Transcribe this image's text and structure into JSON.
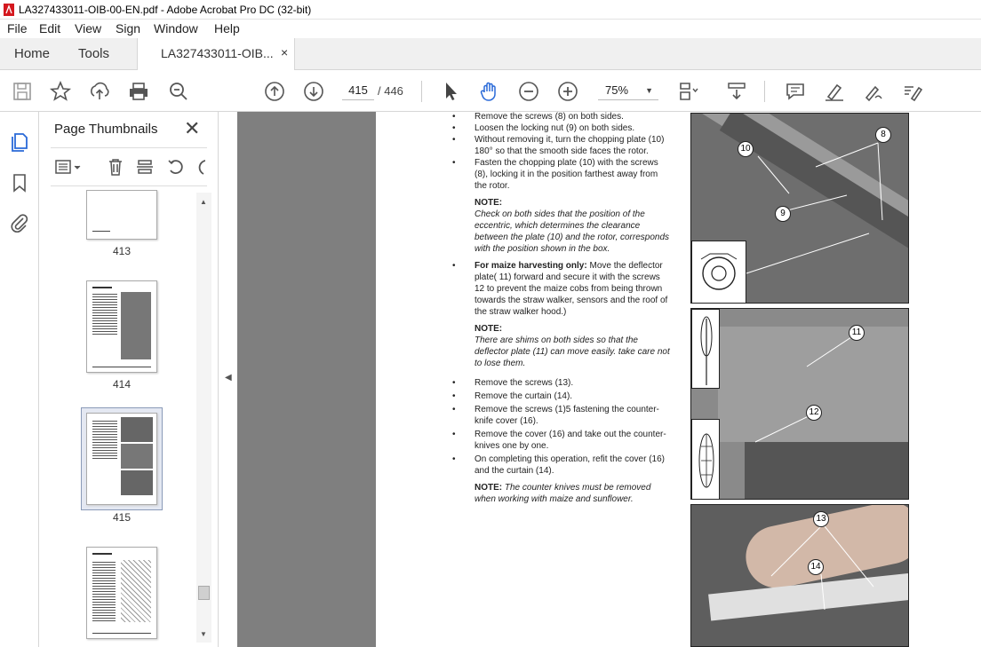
{
  "window": {
    "title": "LA327433011-OIB-00-EN.pdf - Adobe Acrobat Pro DC (32-bit)"
  },
  "menu": [
    "File",
    "Edit",
    "View",
    "Sign",
    "Window",
    "Help"
  ],
  "tabs": {
    "home": "Home",
    "tools": "Tools",
    "document": "LA327433011-OIB...",
    "close": "×"
  },
  "toolbar": {
    "current_page": "415",
    "page_total": "/ 446",
    "zoom": "75%"
  },
  "sidebar": {
    "title": "Page Thumbnails",
    "close": "✕",
    "thumbnails": [
      {
        "label": "413"
      },
      {
        "label": "414"
      },
      {
        "label": "415",
        "selected": true
      },
      {
        "label": ""
      }
    ]
  },
  "document": {
    "bullets_1": [
      "Remove the screws (8) on both sides.",
      "Loosen the locking nut (9) on both sides.",
      "Without removing it, turn the chopping plate (10) 180° so that the smooth side faces the rotor.",
      "Fasten the chopping plate (10) with the screws (8), locking it in the position farthest away from the rotor."
    ],
    "note1_title": "NOTE:",
    "note1_text": "Check on both sides that the position of the eccentric, which determines the clearance between the plate (10) and the rotor, corresponds with the position shown in the box.",
    "maize_bold": "For maize harvesting only:",
    "maize_text": "Move the deflector plate( 11) forward and secure it with the screws 12 to prevent the maize cobs from being thrown towards the straw walker, sensors and the roof of the straw walker hood.)",
    "note2_title": "NOTE:",
    "note2_text": "There are shims on both sides so that the deflector plate (11) can move easily. take care not to lose them.",
    "bullets_2": [
      "Remove the screws (13).",
      "Remove the curtain (14).",
      "Remove the screws (1)5 fastening the counter-knife cover (16).",
      "Remove the cover (16) and take out the counter-knives one by one.",
      "On completing this operation, refit the cover (16) and the curtain (14)."
    ],
    "note3_title": "NOTE:",
    "note3_text": "The counter knives must be removed when working with maize and sunflower.",
    "callouts": [
      "8",
      "10",
      "9",
      "11",
      "12",
      "13",
      "14"
    ]
  }
}
